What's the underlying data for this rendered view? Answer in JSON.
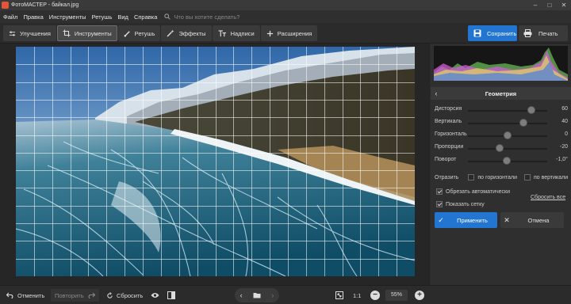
{
  "window": {
    "title": "ФотоМАСТЕР - байкал.jpg"
  },
  "menu": {
    "items": [
      "Файл",
      "Правка",
      "Инструменты",
      "Ретушь",
      "Вид",
      "Справка"
    ],
    "search_placeholder": "Что вы хотите сделать?"
  },
  "tabs": [
    {
      "label": "Улучшения",
      "icon": "sliders-icon"
    },
    {
      "label": "Инструменты",
      "icon": "crop-icon",
      "active": true
    },
    {
      "label": "Ретушь",
      "icon": "brush-icon"
    },
    {
      "label": "Эффекты",
      "icon": "magic-wand-icon"
    },
    {
      "label": "Надписи",
      "icon": "text-icon"
    },
    {
      "label": "Расширения",
      "icon": "plus-icon"
    }
  ],
  "actions": {
    "save": "Сохранить",
    "print": "Печать"
  },
  "panel": {
    "title": "Геометрия",
    "sliders": [
      {
        "label": "Дисторсия",
        "value": "60",
        "pos": 0.8
      },
      {
        "label": "Вертикаль",
        "value": "40",
        "pos": 0.7
      },
      {
        "label": "Горизонталь",
        "value": "0",
        "pos": 0.5
      },
      {
        "label": "Пропорции",
        "value": "-20",
        "pos": 0.4
      },
      {
        "label": "Поворот",
        "value": "-1,0°",
        "pos": 0.49
      }
    ],
    "reflect_label": "Отразить",
    "reflect_horizontal": "по горизонтали",
    "reflect_vertical": "по вертикали",
    "auto_crop": "Обрезать автоматически",
    "show_grid": "Показать сетку",
    "reset_all": "Сбросить все",
    "apply": "Применить",
    "cancel": "Отмена"
  },
  "bottom": {
    "undo": "Отменить",
    "redo": "Повторить",
    "reset": "Сбросить",
    "ratio": "1:1",
    "zoom": "55%"
  }
}
